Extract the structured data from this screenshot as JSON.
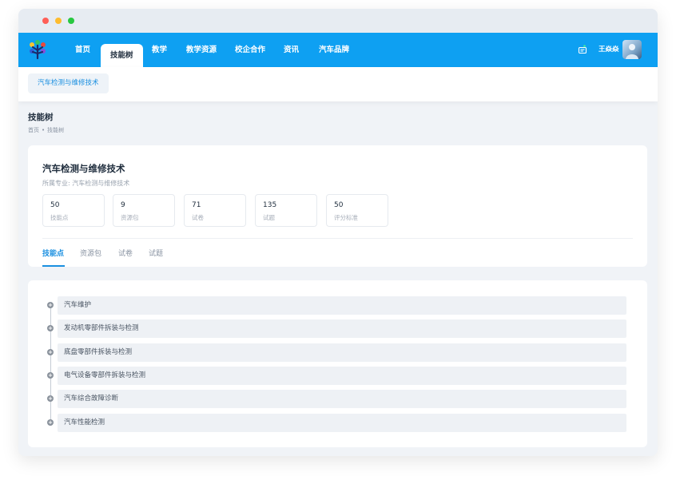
{
  "nav": {
    "items": [
      {
        "label": "首页",
        "active": false
      },
      {
        "label": "技能树",
        "active": true
      },
      {
        "label": "教学",
        "active": false
      },
      {
        "label": "教学资源",
        "active": false
      },
      {
        "label": "校企合作",
        "active": false
      },
      {
        "label": "资讯",
        "active": false
      },
      {
        "label": "汽车品牌",
        "active": false
      }
    ],
    "user_name": "王焱焱",
    "accent_color": "#0ea0f2"
  },
  "subnav": {
    "tab_label": "汽车检测与维修技术"
  },
  "page": {
    "title": "技能树",
    "breadcrumb": [
      "首页",
      "技能树"
    ],
    "breadcrumb_sep": "•"
  },
  "course": {
    "title": "汽车检测与维修技术",
    "major": "所属专业: 汽车检测与维修技术",
    "stats": [
      {
        "value": "50",
        "label": "技能点"
      },
      {
        "value": "9",
        "label": "资源包"
      },
      {
        "value": "71",
        "label": "试卷"
      },
      {
        "value": "135",
        "label": "试题"
      },
      {
        "value": "50",
        "label": "评分标准"
      }
    ],
    "tabs": [
      {
        "label": "技能点",
        "active": true
      },
      {
        "label": "资源包",
        "active": false
      },
      {
        "label": "试卷",
        "active": false
      },
      {
        "label": "试题",
        "active": false
      }
    ]
  },
  "tree": {
    "items": [
      {
        "label": "汽车维护",
        "icon": "plus-circle-icon"
      },
      {
        "label": "发动机零部件拆装与检测",
        "icon": "plus-circle-icon"
      },
      {
        "label": "底盘零部件拆装与检测",
        "icon": "plus-circle-icon"
      },
      {
        "label": "电气设备零部件拆装与检测",
        "icon": "plus-circle-icon"
      },
      {
        "label": "汽车综合故障诊断",
        "icon": "plus-circle-icon"
      },
      {
        "label": "汽车性能检测",
        "icon": "plus-circle-icon"
      }
    ]
  }
}
